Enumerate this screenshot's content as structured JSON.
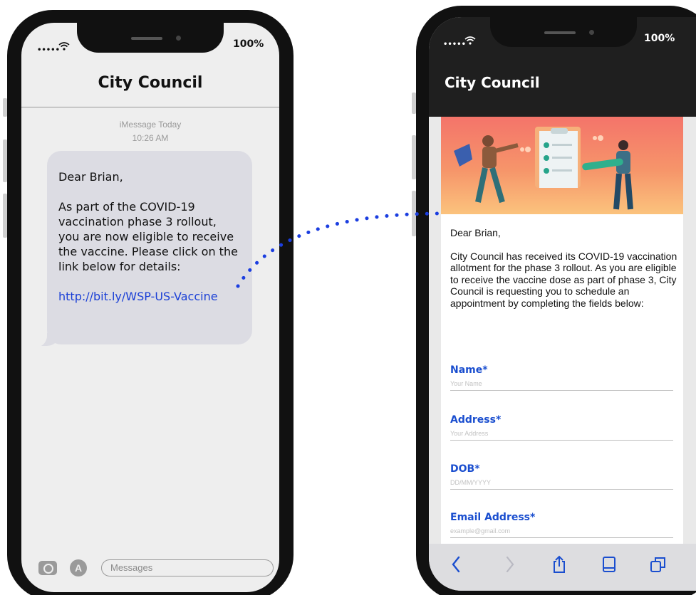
{
  "left_phone": {
    "status": {
      "signal_dots": "•••••",
      "battery": "100%"
    },
    "title": "City Council",
    "meta": {
      "service": "iMessage Today",
      "time": "10:26 AM"
    },
    "message": {
      "greeting": "Dear Brian,",
      "body": "As part of the COVID-19 vaccination phase 3 rollout, you are now eligible to receive the vaccine. Please click on the link below for details:",
      "link": "http://bit.ly/WSP-US-Vaccine"
    },
    "composer": {
      "placeholder": "Messages"
    }
  },
  "right_phone": {
    "status": {
      "signal_dots": "•••••",
      "battery": "100%"
    },
    "title": "City Council",
    "greeting": "Dear Brian,",
    "body": "City Council has received its COVID-19 vaccination allotment for the phase 3 rollout. As you are eligible to receive the vaccine dose as part of phase 3, City Council is requesting you to schedule an appointment by completing the fields below:",
    "fields": [
      {
        "label": "Name*",
        "placeholder": "Your Name"
      },
      {
        "label": "Address*",
        "placeholder": "Your Address"
      },
      {
        "label": "DOB*",
        "placeholder": "DD/MM/YYYY"
      },
      {
        "label": "Email Address*",
        "placeholder": "example@gmail.com"
      }
    ],
    "toolbar": [
      "back-icon",
      "forward-icon",
      "share-icon",
      "bookmarks-icon",
      "tabs-icon"
    ]
  },
  "colors": {
    "link": "#1a3fd6",
    "field_label": "#1a4ecf",
    "connector_dots": "#1b3ee0"
  }
}
